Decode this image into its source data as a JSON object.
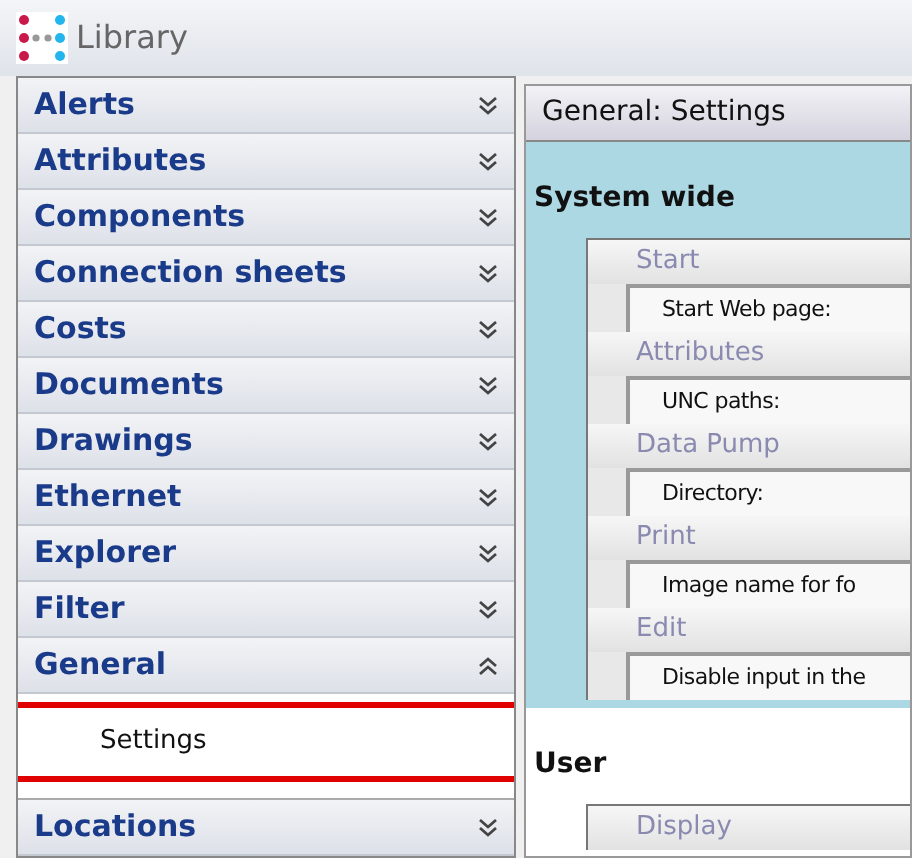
{
  "window": {
    "title": "Library"
  },
  "sidebar": {
    "groups": [
      {
        "label": "Alerts",
        "expanded": false
      },
      {
        "label": "Attributes",
        "expanded": false
      },
      {
        "label": "Components",
        "expanded": false
      },
      {
        "label": "Connection sheets",
        "expanded": false
      },
      {
        "label": "Costs",
        "expanded": false
      },
      {
        "label": "Documents",
        "expanded": false
      },
      {
        "label": "Drawings",
        "expanded": false
      },
      {
        "label": "Ethernet",
        "expanded": false
      },
      {
        "label": "Explorer",
        "expanded": false
      },
      {
        "label": "Filter",
        "expanded": false
      },
      {
        "label": "General",
        "expanded": true,
        "children": [
          {
            "label": "Settings",
            "selected": true
          }
        ]
      },
      {
        "label": "Locations",
        "expanded": false
      }
    ]
  },
  "panel": {
    "title": "General: Settings",
    "sections": [
      {
        "title": "System wide",
        "highlighted": true,
        "categories": [
          {
            "label": "Start",
            "items": [
              "Start Web page:"
            ]
          },
          {
            "label": "Attributes",
            "items": [
              "UNC paths:"
            ]
          },
          {
            "label": "Data Pump",
            "items": [
              "Directory:"
            ]
          },
          {
            "label": "Print",
            "items": [
              "Image name for fo"
            ]
          },
          {
            "label": "Edit",
            "items": [
              "Disable input in the"
            ]
          }
        ]
      },
      {
        "title": "User",
        "highlighted": false,
        "categories": [
          {
            "label": "Display"
          }
        ]
      }
    ]
  }
}
